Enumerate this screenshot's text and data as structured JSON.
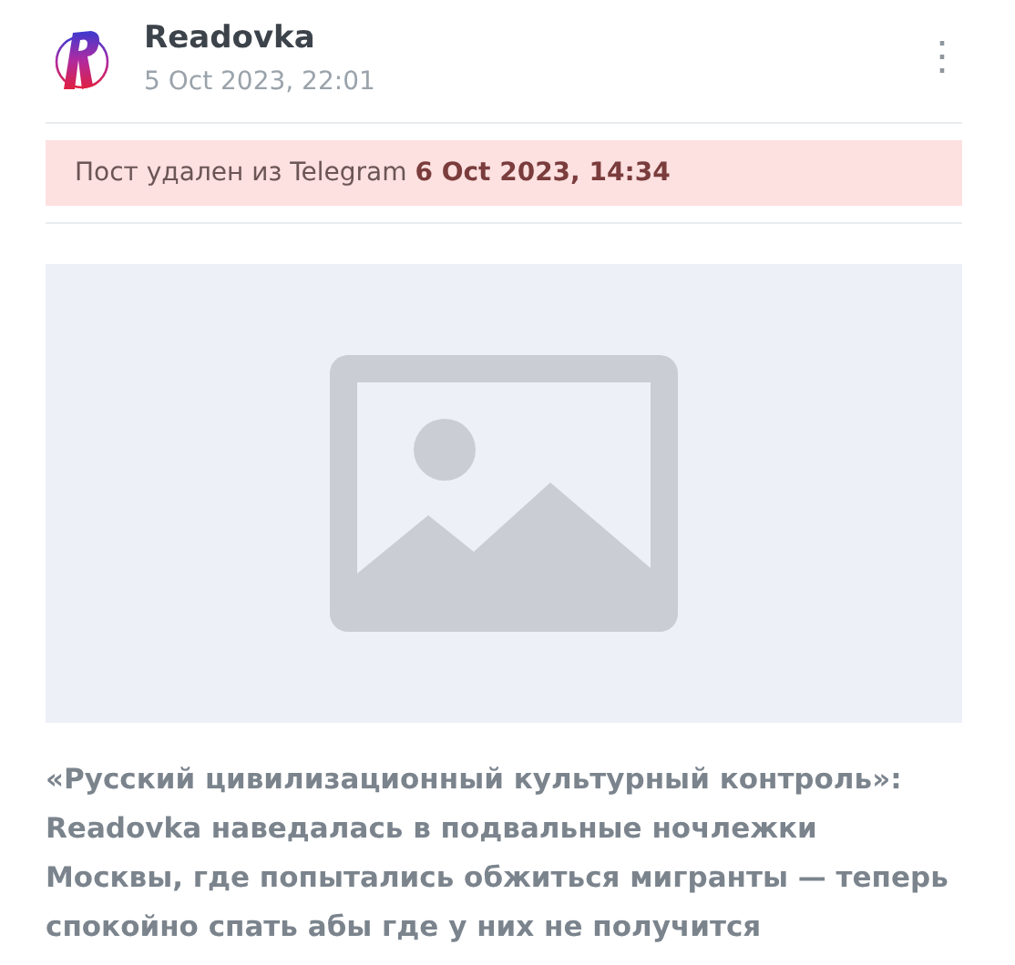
{
  "post": {
    "author": "Readovka",
    "date": "5 Oct 2023, 22:01",
    "menu_icon": "⋮",
    "deleted_notice": "Пост удален из Telegram **6 Oct 2023, 14:34**",
    "text": "«Русский цивилизационный культурный контроль»: Readovka наведалась в подвальные ночлежки Москвы, где попытались обжиться мигранты — теперь спокойно спать абы где у них не получится"
  }
}
